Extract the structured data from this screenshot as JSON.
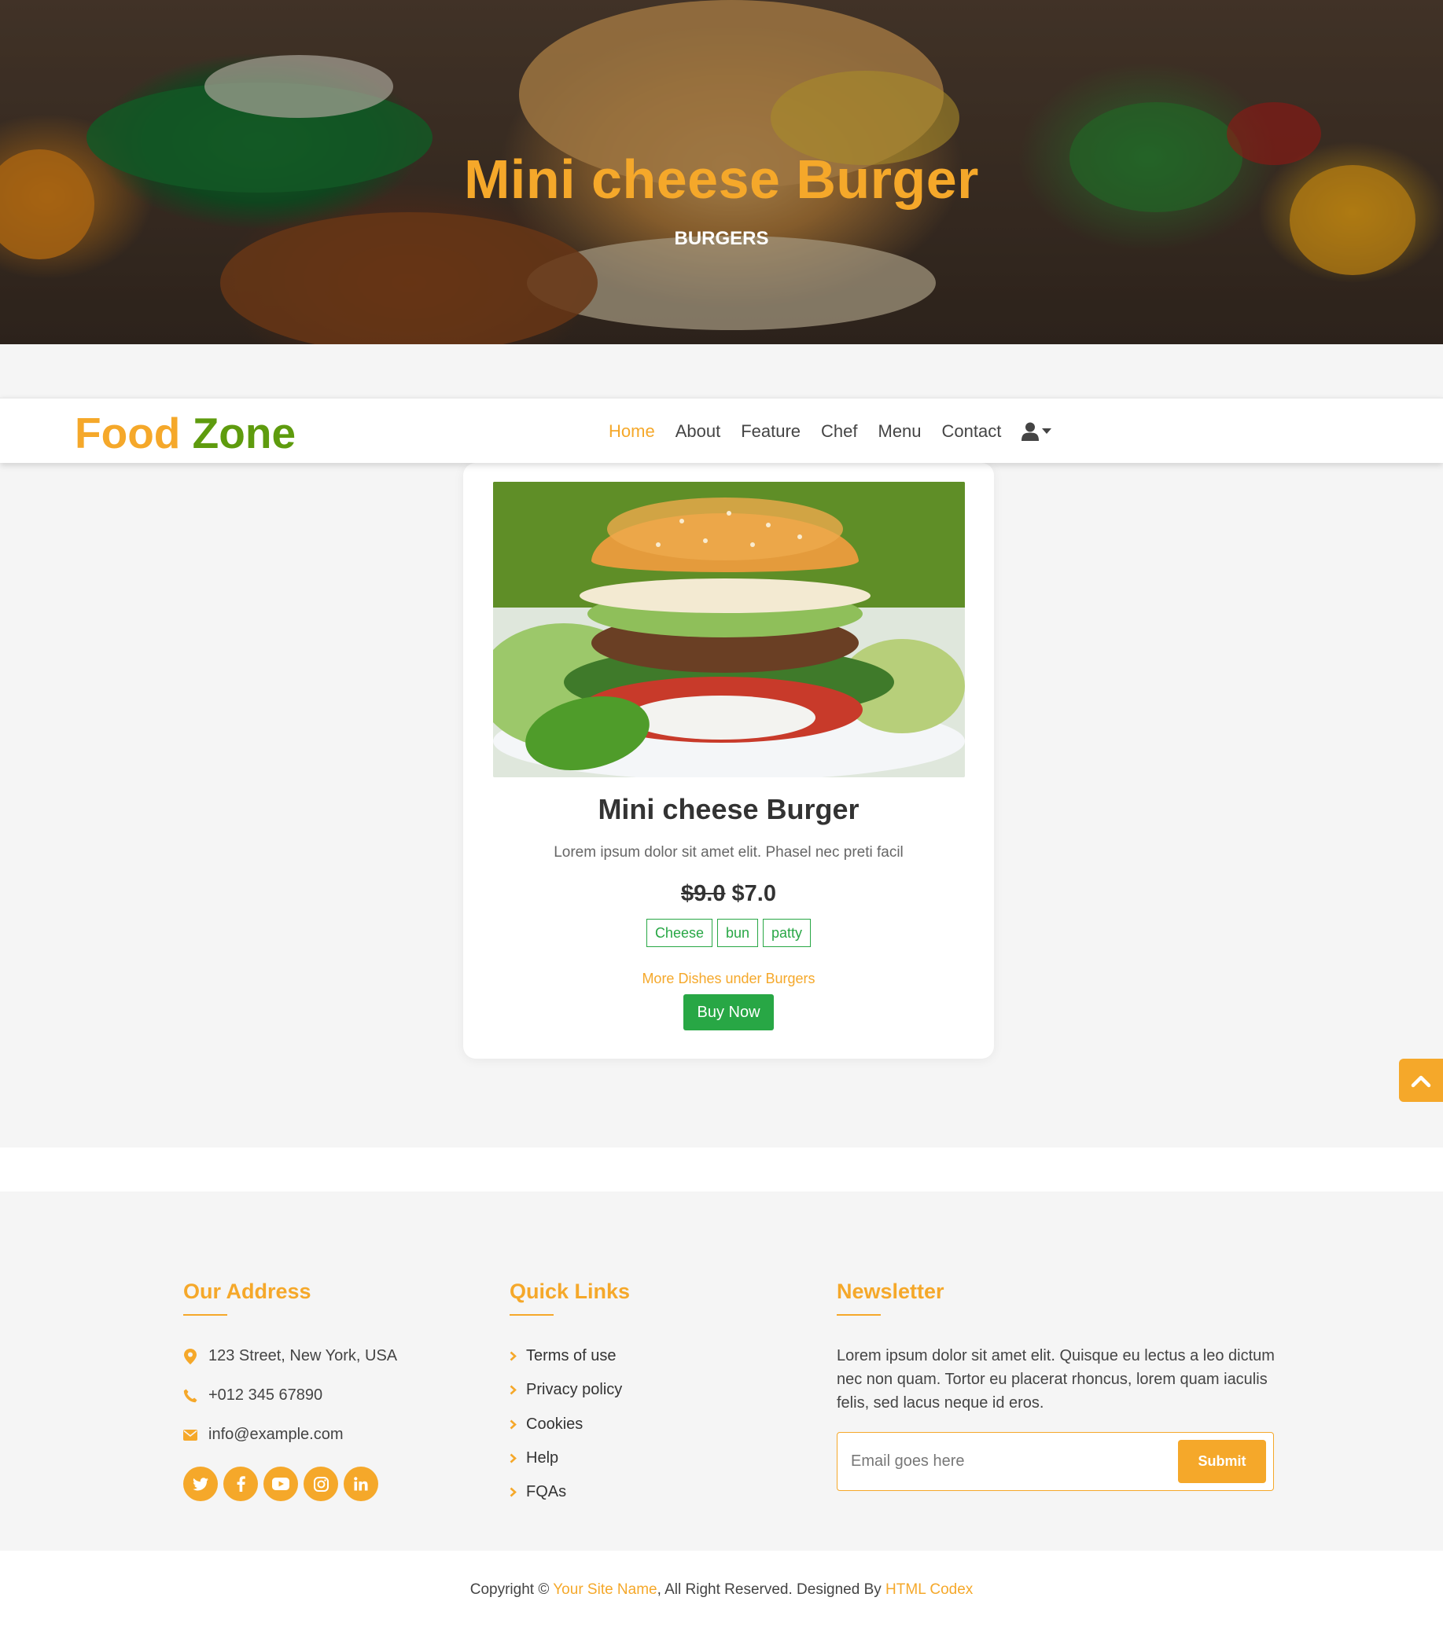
{
  "hero": {
    "title": "Mini cheese Burger",
    "subtitle": "BURGERS"
  },
  "navbar": {
    "brand_part1": "Food",
    "brand_part2": "Zone",
    "links": [
      {
        "label": "Home",
        "active": true
      },
      {
        "label": "About",
        "active": false
      },
      {
        "label": "Feature",
        "active": false
      },
      {
        "label": "Chef",
        "active": false
      },
      {
        "label": "Menu",
        "active": false
      },
      {
        "label": "Contact",
        "active": false
      }
    ],
    "user_icon": "user-icon"
  },
  "product": {
    "title": "Mini cheese Burger",
    "description": "Lorem ipsum dolor sit amet elit. Phasel nec preti facil",
    "old_price": "$9.0",
    "new_price": "$7.0",
    "tags": [
      "Cheese",
      "bun",
      "patty"
    ],
    "more_link": "More Dishes under Burgers",
    "buy_label": "Buy Now"
  },
  "footer": {
    "address": {
      "heading": "Our Address",
      "street": "123 Street, New York, USA",
      "phone": "+012 345 67890",
      "email": "info@example.com",
      "socials": [
        "twitter-icon",
        "facebook-icon",
        "youtube-icon",
        "instagram-icon",
        "linkedin-icon"
      ]
    },
    "quick_links": {
      "heading": "Quick Links",
      "items": [
        "Terms of use",
        "Privacy policy",
        "Cookies",
        "Help",
        "FQAs"
      ]
    },
    "newsletter": {
      "heading": "Newsletter",
      "text": "Lorem ipsum dolor sit amet elit. Quisque eu lectus a leo dictum nec non quam. Tortor eu placerat rhoncus, lorem quam iaculis felis, sed lacus neque id eros.",
      "placeholder": "Email goes here",
      "submit_label": "Submit"
    }
  },
  "copyright": {
    "prefix": "Copyright © ",
    "site_name": "Your Site Name",
    "middle": ", All Right Reserved. Designed By ",
    "designer": "HTML Codex"
  },
  "colors": {
    "accent": "#F5A82A",
    "brand_green": "#5E9B0E",
    "button_green": "#28A745"
  }
}
